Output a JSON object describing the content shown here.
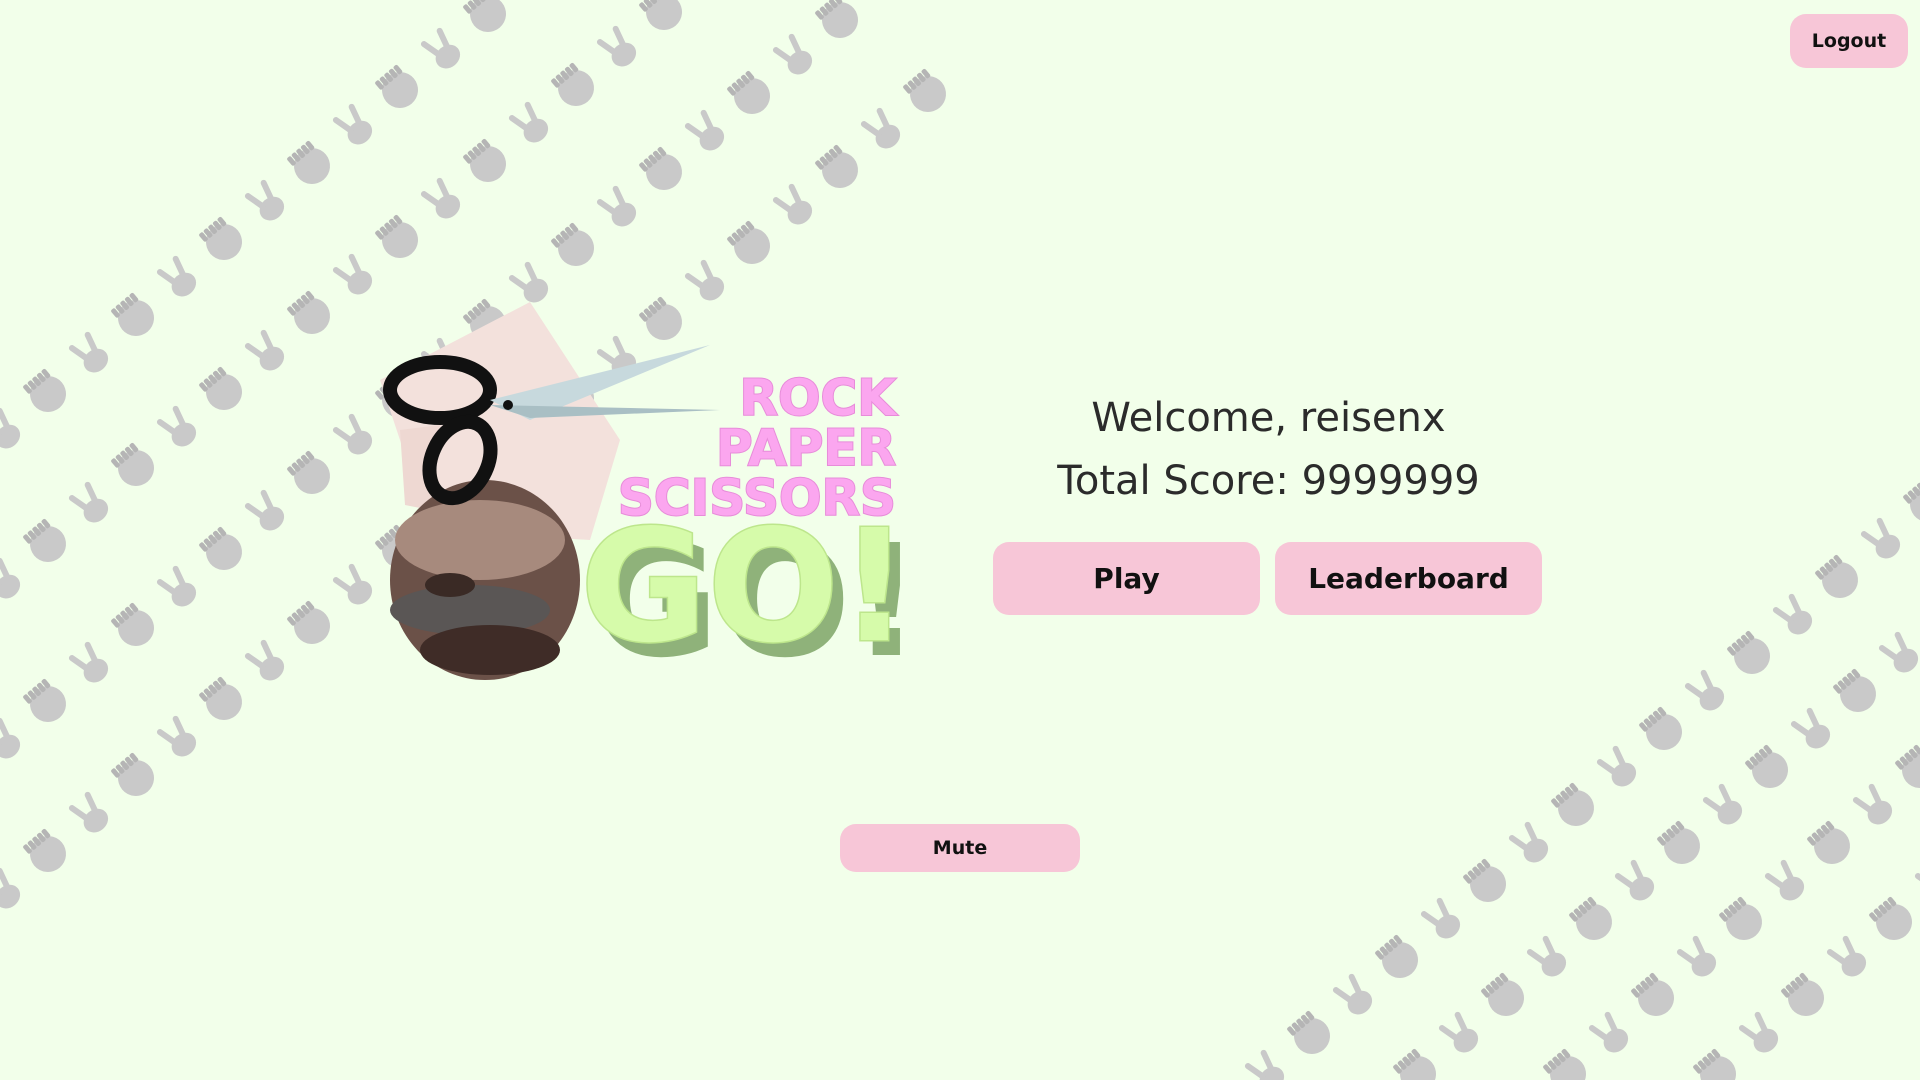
{
  "header": {
    "logout_label": "Logout"
  },
  "logo": {
    "line1": "ROCK",
    "line2": "PAPER",
    "line3": "SCISSORS",
    "line4": "GO!"
  },
  "user": {
    "welcome_label": "Welcome, reisenx",
    "score_label": "Total Score: 9999999"
  },
  "actions": {
    "play_label": "Play",
    "leaderboard_label": "Leaderboard",
    "mute_label": "Mute"
  },
  "colors": {
    "background": "#f2ffea",
    "button": "#f7c6d7",
    "logo_pink": "#fba6ef",
    "logo_green": "#d6fbaa",
    "pattern_gray": "#c9c9c9"
  },
  "icons": {
    "pattern": [
      "rock-hand-icon",
      "scissors-hand-icon"
    ]
  }
}
